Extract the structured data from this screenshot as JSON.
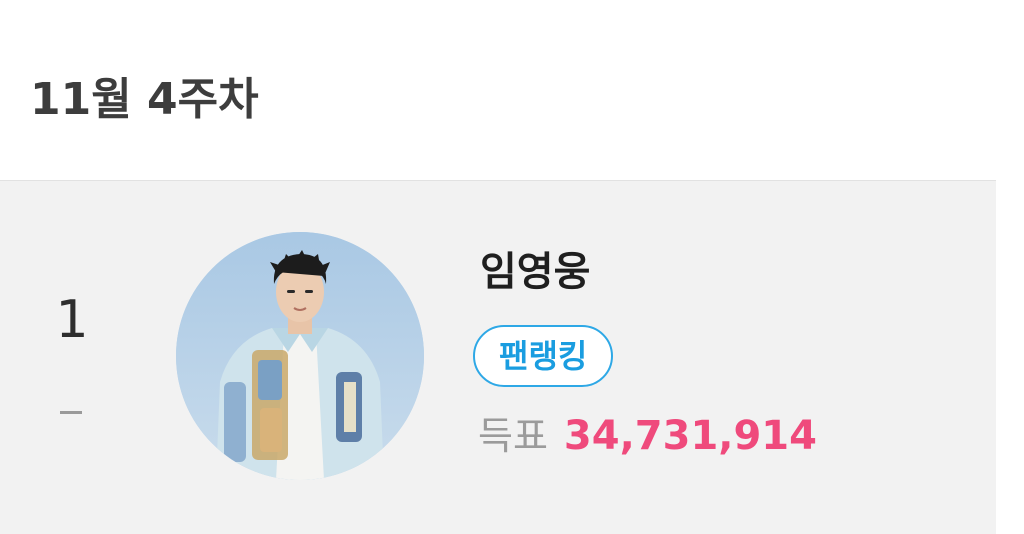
{
  "header": {
    "week_label": "11월 4주차"
  },
  "ranking": {
    "rank": "1",
    "rank_change": "–",
    "artist_name": "임영웅",
    "badge_label": "팬랭킹",
    "votes_label": "득표",
    "votes_value": "34,731,914"
  },
  "colors": {
    "accent_blue": "#1a9de0",
    "votes_pink": "#ef4a7c",
    "card_background": "#f2f2f2"
  }
}
